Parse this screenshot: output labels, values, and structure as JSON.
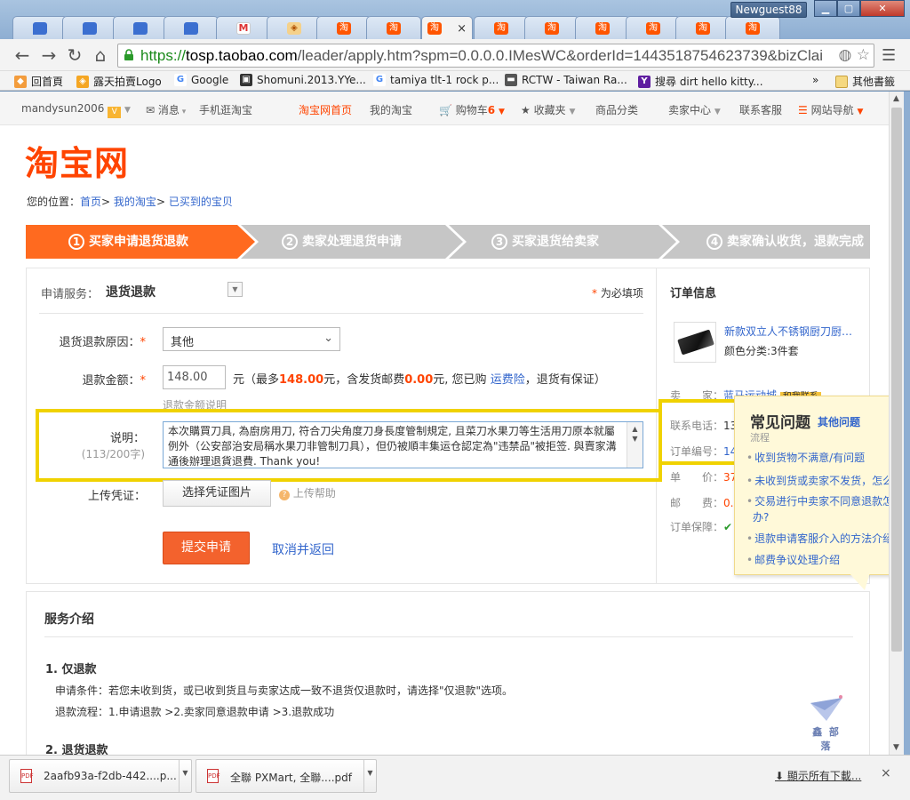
{
  "window": {
    "user_badge": "Newguest88",
    "tabs": [
      {
        "icon": "blue-bubble-icon",
        "label": ""
      },
      {
        "icon": "blue-bubble-icon",
        "label": ""
      },
      {
        "icon": "blue-bubble-icon",
        "label": ""
      },
      {
        "icon": "blue-bubble-icon",
        "label": ""
      },
      {
        "icon": "gmail-icon",
        "label": "M"
      },
      {
        "icon": "auction-icon",
        "label": "◈"
      },
      {
        "icon": "taobao-icon",
        "label": "淘"
      },
      {
        "icon": "taobao-icon",
        "label": "淘"
      },
      {
        "icon": "taobao-icon",
        "label": "淘",
        "active": true
      },
      {
        "icon": "taobao-icon",
        "label": "淘"
      },
      {
        "icon": "taobao-icon",
        "label": "淘"
      },
      {
        "icon": "taobao-icon",
        "label": "淘"
      },
      {
        "icon": "taobao-icon",
        "label": "淘"
      },
      {
        "icon": "taobao-icon",
        "label": "淘"
      },
      {
        "icon": "taobao-icon",
        "label": "淘"
      }
    ],
    "close_glyph": "×"
  },
  "toolbar": {
    "url_scheme": "https://",
    "url_host": "tosp.taobao.com",
    "url_path": "/leader/apply.htm?spm=0.0.0.0.IMesWC&orderId=1443518754623739&bizClai"
  },
  "bookmarks": {
    "items": [
      {
        "label": "回首頁",
        "icon": "orange-icon"
      },
      {
        "label": "露天拍賣Logo",
        "icon": "ruten-icon"
      },
      {
        "label": "Google",
        "icon": "google-icon"
      },
      {
        "label": "Shomuni.2013.YYe...",
        "icon": "film-icon"
      },
      {
        "label": "tamiya tlt-1 rock p...",
        "icon": "google-icon"
      },
      {
        "label": "RCTW - Taiwan Ra...",
        "icon": "car-icon"
      },
      {
        "label": "搜尋 dirt hello kitty...",
        "icon": "yahoo-icon"
      }
    ],
    "overflow": "»",
    "other": "其他書籤"
  },
  "site_nav": {
    "user": "mandysun2006",
    "message": "消息",
    "mobile": "手机逛淘宝",
    "home": "淘宝网首页",
    "my_taobao": "我的淘宝",
    "cart": "购物车",
    "cart_count": "6",
    "favorites": "收藏夹",
    "categories": "商品分类",
    "seller_center": "卖家中心",
    "service": "联系客服",
    "site_nav": "网站导航"
  },
  "logo": "淘宝网",
  "breadcrumb": {
    "prefix": "您的位置：",
    "home": "首页",
    "my_taobao": "我的淘宝",
    "bought": "已买到的宝贝",
    "sep": ">"
  },
  "steps": [
    {
      "num": "1",
      "label": "买家申请退货退款"
    },
    {
      "num": "2",
      "label": "卖家处理退货申请"
    },
    {
      "num": "3",
      "label": "买家退货给卖家"
    },
    {
      "num": "4",
      "label": "卖家确认收货，退款完成"
    }
  ],
  "form": {
    "service_label": "申请服务：",
    "service_value": "退货退款",
    "required_note": "为必填项",
    "required_star": "*",
    "reason_label": "退货退款原因：",
    "reason_value": "其他",
    "amount_label": "退款金额：",
    "amount_value": "148.00",
    "amount_unit": "元（最多",
    "amount_max": "148.00",
    "amount_mid": "元，含发货邮费",
    "shipping_fee": "0.00",
    "amount_mid2": "元, 您已购",
    "insurance_link": "运费险",
    "amount_end": "，退货有保证）",
    "amount_help": "退款金额说明",
    "desc_label": "说明：",
    "desc_count": "(113/200字)",
    "desc_text": "本次購買刀具, 為廚房用刀, 符合刀尖角度刀身長度管制規定, 且菜刀水果刀等生活用刀原本就屬例外（公安部治安局稱水果刀非管制刀具），但仍被順丰集运仓認定為\"违禁品\"被拒签. 與賣家溝通後辦理退貨退費. Thank you!",
    "upload_label": "上传凭证：",
    "upload_button": "选择凭证图片",
    "upload_help": "上传帮助",
    "submit": "提交申请",
    "cancel": "取消并返回"
  },
  "order_info": {
    "title": "订单信息",
    "product": "新款双立人不锈钢厨刀厨具套装",
    "attr": "颜色分类:3件套",
    "seller_label": "卖　　家：",
    "seller_value": "蓝马运动城",
    "contact_badge": "和我联系",
    "phone_label": "联系电话：",
    "phone_value": "13",
    "order_no_label": "订单编号：",
    "order_no_value": "14",
    "price_label": "单　　价：",
    "price_value": "37",
    "shipping_label": "邮　　费：",
    "shipping_value": "0.",
    "guarantee_label": "订单保障："
  },
  "help_popup": {
    "title": "常见问题",
    "more": "其他问题",
    "partial": "流程",
    "items": [
      "收到货物不满意/有问题",
      "未收到货或卖家不发货，怎么办",
      "交易进行中卖家不同意退款怎么",
      "办?",
      "退款申请客服介入的方法介绍",
      "邮费争议处理介绍"
    ]
  },
  "service_intro": {
    "title": "服务介绍",
    "s1_title": "1. 仅退款",
    "s1_cond": "申请条件：若您未收到货，或已收到货且与卖家达成一致不退货仅退款时，请选择\"仅退款\"选项。",
    "s1_flow": "退款流程：1.申请退款 >2.卖家同意退款申请 >3.退款成功",
    "s2_title": "2. 退货退款"
  },
  "watermark": "鑫 部 落",
  "downloads": {
    "items": [
      {
        "name": "2aafb93a-f2db-442....p..."
      },
      {
        "name": "全聯 PXMart, 全聯....pdf"
      }
    ],
    "show_all": "顯示所有下載...",
    "close": "×"
  }
}
